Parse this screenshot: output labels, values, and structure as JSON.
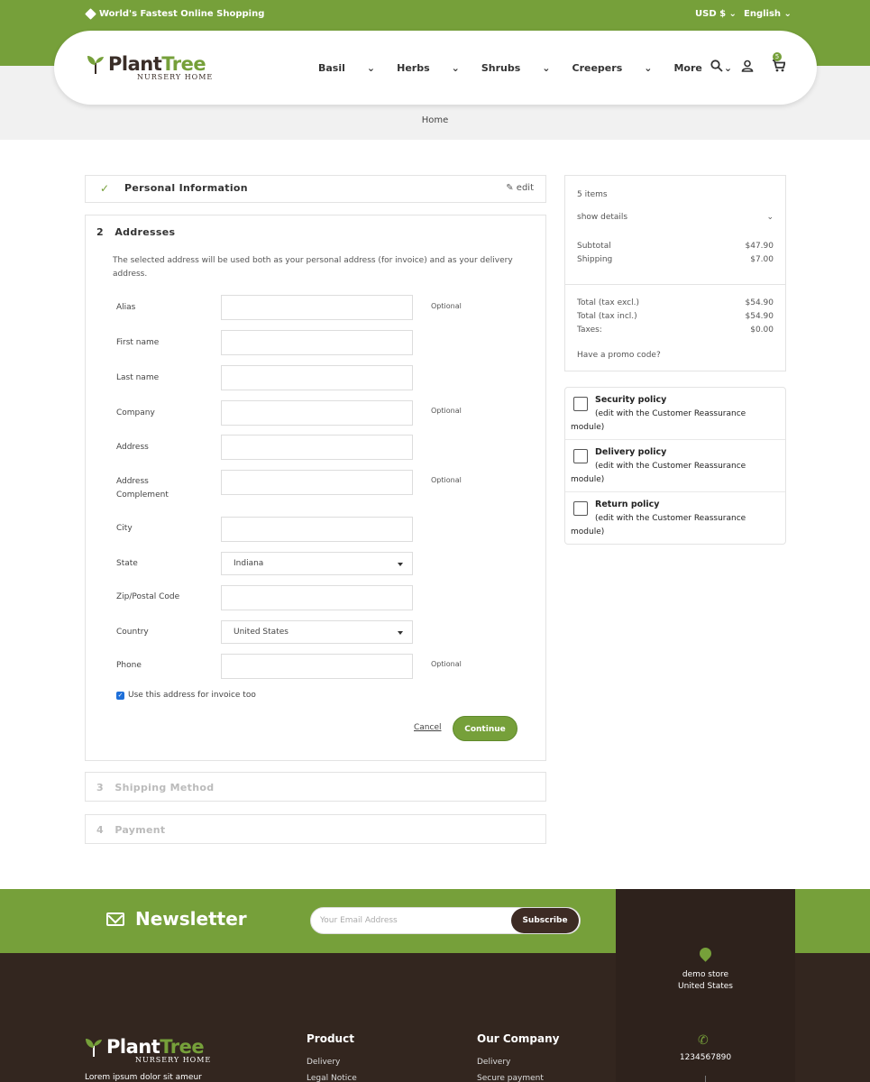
{
  "topbar": {
    "promo": "World's Fastest Online Shopping",
    "currency": "USD $",
    "language": "English"
  },
  "header": {
    "logo_main_1": "Plant",
    "logo_main_2": "Tree",
    "logo_sub": "NURSERY HOME",
    "nav": [
      "Basil",
      "Herbs",
      "Shrubs",
      "Creepers",
      "More"
    ],
    "cart_count": "5"
  },
  "breadcrumb": "Home",
  "checkout": {
    "step1_title": "Personal Information",
    "step1_edit": "edit",
    "step2_number": "2",
    "step2_title": "Addresses",
    "step2_desc": "The selected address will be used both as your personal address (for invoice) and as your delivery address.",
    "fields": {
      "alias": "Alias",
      "first_name": "First name",
      "last_name": "Last name",
      "company": "Company",
      "address": "Address",
      "address_complement": "Address Complement",
      "city": "City",
      "state": "State",
      "zip": "Zip/Postal Code",
      "country": "Country",
      "phone": "Phone"
    },
    "optional": "Optional",
    "state_value": "Indiana",
    "country_value": "United States",
    "invoice_label": "Use this address for invoice too",
    "cancel": "Cancel",
    "continue": "Continue",
    "step3_number": "3",
    "step3_title": "Shipping Method",
    "step4_number": "4",
    "step4_title": "Payment"
  },
  "summary": {
    "items": "5 items",
    "show_details": "show details",
    "subtotal_label": "Subtotal",
    "subtotal": "$47.90",
    "shipping_label": "Shipping",
    "shipping": "$7.00",
    "total_excl_label": "Total (tax excl.)",
    "total_excl": "$54.90",
    "total_incl_label": "Total (tax incl.)",
    "total_incl": "$54.90",
    "taxes_label": "Taxes:",
    "taxes": "$0.00",
    "promo": "Have a promo code?"
  },
  "reassurance": [
    {
      "title": "Security policy",
      "desc": "(edit with the Customer Reassurance module)"
    },
    {
      "title": "Delivery policy",
      "desc": "(edit with the Customer Reassurance module)"
    },
    {
      "title": "Return policy",
      "desc": "(edit with the Customer Reassurance module)"
    }
  ],
  "newsletter": {
    "title": "Newsletter",
    "placeholder": "Your Email Address",
    "button": "Subscribe"
  },
  "footer": {
    "store_name": "demo store",
    "store_country": "United States",
    "phone": "1234567890",
    "lorem": "Lorem ipsum dolor sit ameur",
    "col1_title": "Product",
    "col1_items": [
      "Delivery",
      "Legal Notice"
    ],
    "col2_title": "Our Company",
    "col2_items": [
      "Delivery",
      "Secure payment"
    ]
  },
  "colors": {
    "brand_green": "#76a03a",
    "dark_brown": "#33261f"
  }
}
